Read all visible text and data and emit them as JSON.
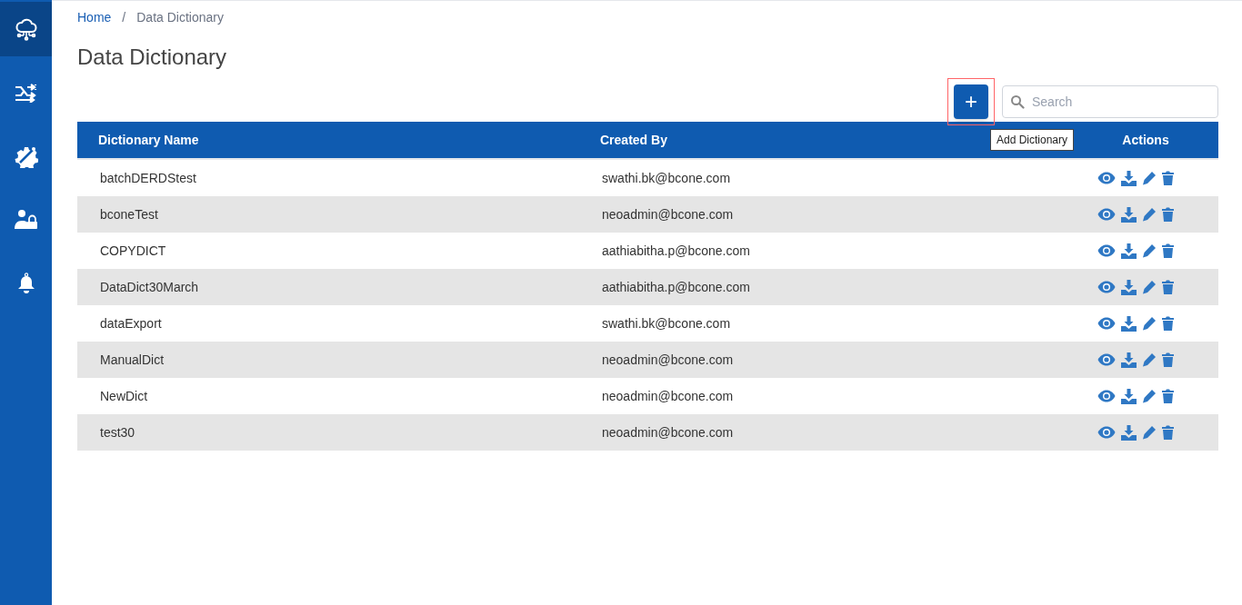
{
  "sidebar": {
    "items": [
      {
        "kind": "cloud",
        "selected": true
      },
      {
        "kind": "shuffle",
        "selected": false
      },
      {
        "kind": "gear",
        "selected": false
      },
      {
        "kind": "user-lock",
        "selected": false
      },
      {
        "kind": "bell",
        "selected": false
      }
    ]
  },
  "breadcrumb": [
    "Home",
    "Data Dictionary"
  ],
  "breadcrumb_separator": "/",
  "page_title": "Data Dictionary",
  "add_button": {
    "label": "+",
    "tooltip": "Add Dictionary"
  },
  "search": {
    "placeholder": "Search"
  },
  "table": {
    "columns": [
      "Dictionary Name",
      "Created By",
      "Actions"
    ],
    "rows": [
      {
        "name": "batchDERDStest",
        "created_by": "swathi.bk@bcone.com"
      },
      {
        "name": "bconeTest",
        "created_by": "neoadmin@bcone.com"
      },
      {
        "name": "COPYDICT",
        "created_by": "aathiabitha.p@bcone.com"
      },
      {
        "name": "DataDict30March",
        "created_by": "aathiabitha.p@bcone.com"
      },
      {
        "name": "dataExport",
        "created_by": "swathi.bk@bcone.com"
      },
      {
        "name": "ManualDict",
        "created_by": "neoadmin@bcone.com"
      },
      {
        "name": "NewDict",
        "created_by": "neoadmin@bcone.com"
      },
      {
        "name": "test30",
        "created_by": "neoadmin@bcone.com"
      }
    ]
  }
}
